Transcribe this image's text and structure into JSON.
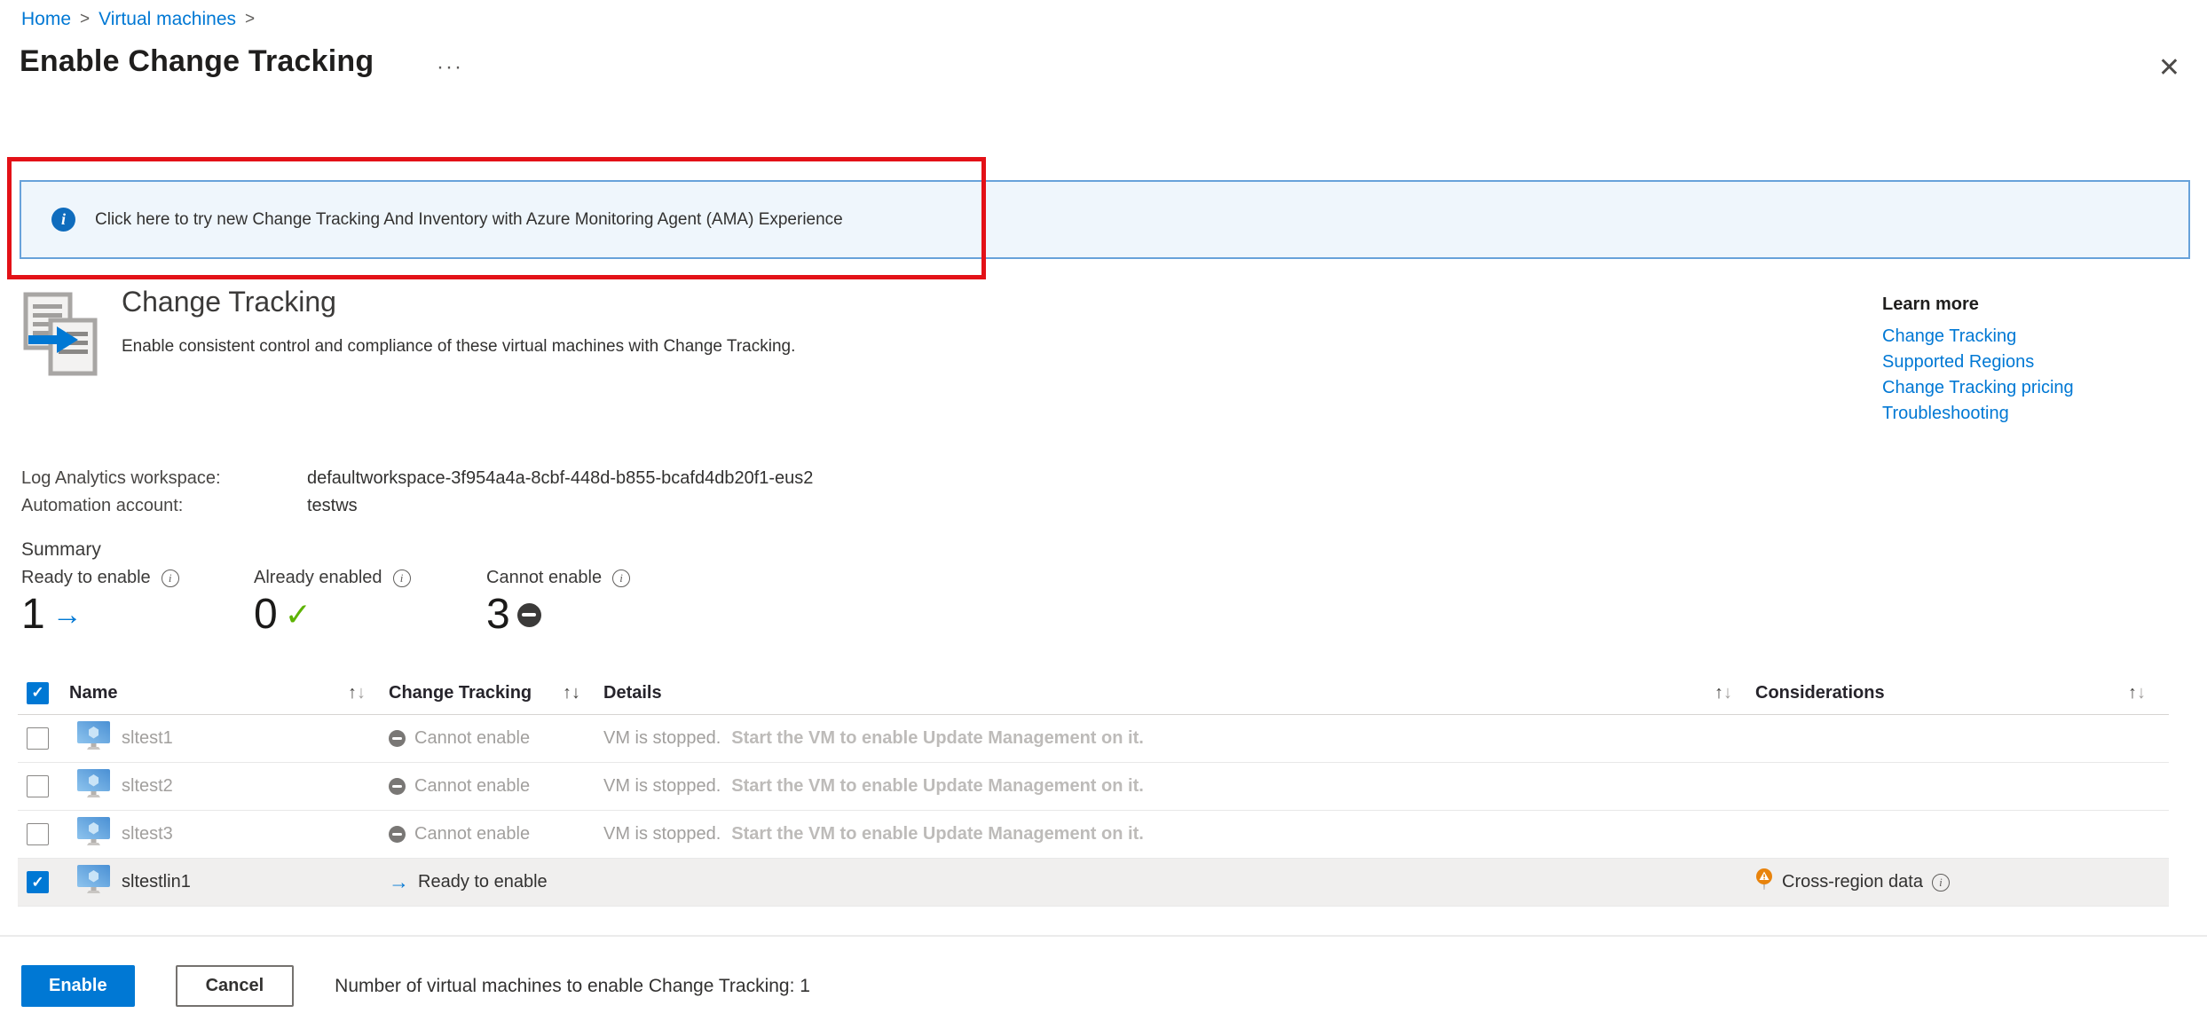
{
  "breadcrumb": {
    "items": [
      {
        "label": "Home"
      },
      {
        "label": "Virtual machines"
      }
    ],
    "separator": ">"
  },
  "page": {
    "title": "Enable Change Tracking",
    "more_label": "···",
    "close_label": "✕"
  },
  "banner": {
    "text": "Click here to try new Change Tracking And Inventory with Azure Monitoring Agent (AMA) Experience"
  },
  "intro": {
    "title": "Change Tracking",
    "description": "Enable consistent control and compliance of these virtual machines with Change Tracking."
  },
  "learn_more": {
    "title": "Learn more",
    "links": [
      {
        "label": "Change Tracking"
      },
      {
        "label": "Supported Regions"
      },
      {
        "label": "Change Tracking pricing"
      },
      {
        "label": "Troubleshooting"
      }
    ]
  },
  "workspace": {
    "log_label": "Log Analytics workspace:",
    "log_value": "defaultworkspace-3f954a4a-8cbf-448d-b855-bcafd4db20f1-eus2",
    "automation_label": "Automation account:",
    "automation_value": "testws"
  },
  "summary": {
    "title": "Summary",
    "ready": {
      "label": "Ready to enable",
      "value": "1"
    },
    "enabled": {
      "label": "Already enabled",
      "value": "0"
    },
    "cannot": {
      "label": "Cannot enable",
      "value": "3"
    }
  },
  "table": {
    "headers": {
      "name": "Name",
      "change_tracking": "Change Tracking",
      "details": "Details",
      "considerations": "Considerations"
    },
    "rows": [
      {
        "name": "sltest1",
        "status": "Cannot enable",
        "details_plain": "VM is stopped.",
        "details_emphasis": "Start the VM to enable Update Management on it.",
        "consideration": ""
      },
      {
        "name": "sltest2",
        "status": "Cannot enable",
        "details_plain": "VM is stopped.",
        "details_emphasis": "Start the VM to enable Update Management on it.",
        "consideration": ""
      },
      {
        "name": "sltest3",
        "status": "Cannot enable",
        "details_plain": "VM is stopped.",
        "details_emphasis": "Start the VM to enable Update Management on it.",
        "consideration": ""
      },
      {
        "name": "sltestlin1",
        "status": "Ready to enable",
        "details_plain": "",
        "details_emphasis": "",
        "consideration": "Cross-region data"
      }
    ]
  },
  "footer": {
    "enable_label": "Enable",
    "cancel_label": "Cancel",
    "note": "Number of virtual machines to enable Change Tracking: 1"
  },
  "icons": {
    "sort_up": "↑",
    "sort_down": "↓",
    "check": "✓",
    "info": "i",
    "arrow_right": "→"
  },
  "colors": {
    "accent": "#0078d4",
    "banner_bg": "#eff6fc",
    "banner_border": "#68a2da",
    "annotation_red": "#e31117",
    "success_green": "#5db300",
    "cannot_gray": "#797775",
    "selected_row_bg": "#f0efee",
    "warning_orange": "#e8830c"
  }
}
